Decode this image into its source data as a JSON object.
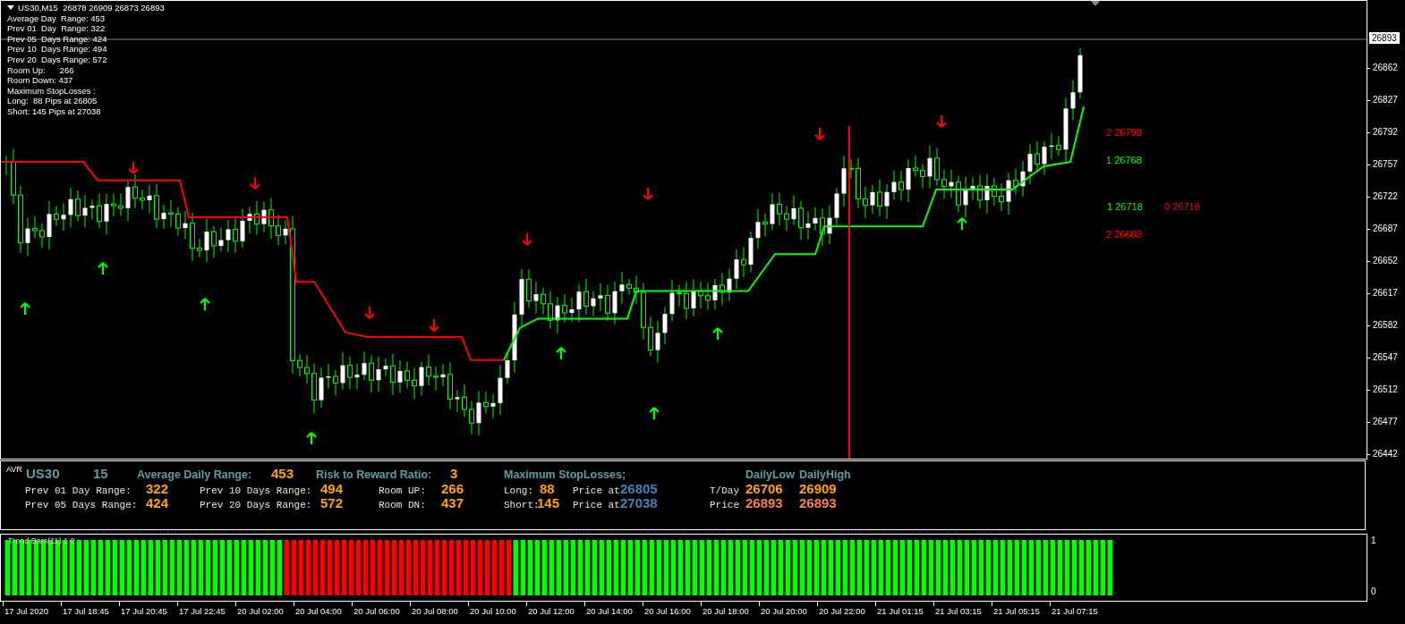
{
  "chart_header": {
    "title": "US30,M15  26878 26909 26873 26893"
  },
  "info_lines": [
    "Average Day  Range: 453",
    "Prev 01  Day  Range: 322",
    "Prev 05  Days Range: 424",
    "Prev 10  Days Range: 494",
    "Prev 20  Days Range: 572",
    "Room Up:      266",
    "Room Down: 437",
    "Maximum StopLosses :",
    "Long:  88 Pips at 26805",
    "Short: 145 Pips at 27038"
  ],
  "price_axis": {
    "current_price": "26893",
    "labels": [
      "26862",
      "26827",
      "26792",
      "26757",
      "26722",
      "26687",
      "26652",
      "26617",
      "26582",
      "26547",
      "26512",
      "26477",
      "26442"
    ]
  },
  "level_labels": [
    {
      "text": "2 26798",
      "color": "#ff0000"
    },
    {
      "text": "1 26768",
      "color": "#00ff00"
    },
    {
      "text": "1 26718",
      "color": "#00ff00"
    },
    {
      "text": "0 26718",
      "color": "#ff0000"
    },
    {
      "text": "2 26688",
      "color": "#ff0000"
    }
  ],
  "avr_panel": {
    "header": [
      {
        "text": "AVR",
        "kind": "tag"
      },
      {
        "text": "US30",
        "kind": "title"
      },
      {
        "text": "15",
        "kind": "title"
      },
      {
        "text": "Average Daily Range:",
        "kind": "heading"
      },
      {
        "text": "453",
        "kind": "value"
      },
      {
        "text": "Risk to Reward Ratio:",
        "kind": "heading"
      },
      {
        "text": "3",
        "kind": "value"
      },
      {
        "text": "Maximum StopLosses;",
        "kind": "heading"
      },
      {
        "text": "DailyLow",
        "kind": "heading"
      },
      {
        "text": "DailyHigh",
        "kind": "heading"
      }
    ],
    "lines": [
      [
        {
          "text": "Prev 01 Day Range:",
          "kind": "label"
        },
        {
          "text": "322",
          "kind": "value"
        },
        {
          "text": "Prev 10 Days Range:",
          "kind": "label"
        },
        {
          "text": "494",
          "kind": "value"
        },
        {
          "text": "Room UP:",
          "kind": "label"
        },
        {
          "text": "266",
          "kind": "value"
        },
        {
          "text": "Long:",
          "kind": "label"
        },
        {
          "text": "88",
          "kind": "value"
        },
        {
          "text": "Price at",
          "kind": "label"
        },
        {
          "text": "26805",
          "kind": "stop"
        },
        {
          "text": "T/Day",
          "kind": "label"
        },
        {
          "text": "26706",
          "kind": "value"
        },
        {
          "text": "26909",
          "kind": "value"
        }
      ],
      [
        {
          "text": "Prev 05 Days Range:",
          "kind": "label"
        },
        {
          "text": "424",
          "kind": "value"
        },
        {
          "text": "Prev 20 Days Range:",
          "kind": "label"
        },
        {
          "text": "572",
          "kind": "value"
        },
        {
          "text": "Room DN:",
          "kind": "label"
        },
        {
          "text": "437",
          "kind": "value"
        },
        {
          "text": "Short:",
          "kind": "label"
        },
        {
          "text": "145",
          "kind": "value"
        },
        {
          "text": "Price at",
          "kind": "label"
        },
        {
          "text": "27038",
          "kind": "stop"
        },
        {
          "text": "Price",
          "kind": "label"
        },
        {
          "text": "26893",
          "kind": "price"
        },
        {
          "text": "26893",
          "kind": "price"
        }
      ]
    ]
  },
  "trend_panel": {
    "title": "Trend Bars(11) 1 0",
    "scale_max": "1",
    "scale_min": "0"
  },
  "time_axis": {
    "labels": [
      "17 Jul 2020",
      "17 Jul 18:45",
      "17 Jul 20:45",
      "17 Jul 22:45",
      "20 Jul 02:00",
      "20 Jul 04:00",
      "20 Jul 06:00",
      "20 Jul 08:00",
      "20 Jul 10:00",
      "20 Jul 12:00",
      "20 Jul 14:00",
      "20 Jul 16:00",
      "20 Jul 18:00",
      "20 Jul 20:00",
      "20 Jul 22:00",
      "21 Jul 01:15",
      "21 Jul 03:15",
      "21 Jul 05:15",
      "21 Jul 07:15"
    ]
  }
}
